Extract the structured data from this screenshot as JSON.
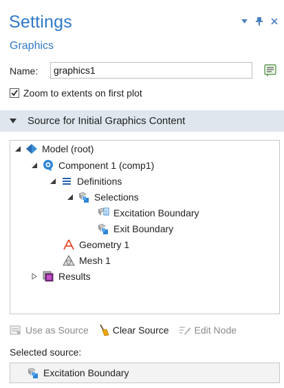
{
  "header": {
    "title": "Settings",
    "subtitle": "Graphics"
  },
  "name_field": {
    "label": "Name:",
    "value": "graphics1"
  },
  "zoom_checkbox": {
    "label": "Zoom to extents on first plot",
    "checked": true
  },
  "section": {
    "title": "Source for Initial Graphics Content"
  },
  "tree": {
    "model": "Model (root)",
    "component": "Component 1 (comp1)",
    "definitions": "Definitions",
    "selections": "Selections",
    "excitation": "Excitation Boundary",
    "exit": "Exit Boundary",
    "geometry": "Geometry 1",
    "mesh": "Mesh 1",
    "results": "Results"
  },
  "actions": {
    "use_as_source": "Use as Source",
    "clear_source": "Clear Source",
    "edit_node": "Edit Node"
  },
  "selected": {
    "label": "Selected source:",
    "value": "Excitation Boundary"
  },
  "colors": {
    "accent": "#2f78c7",
    "section_bg": "#dfe6ee"
  }
}
